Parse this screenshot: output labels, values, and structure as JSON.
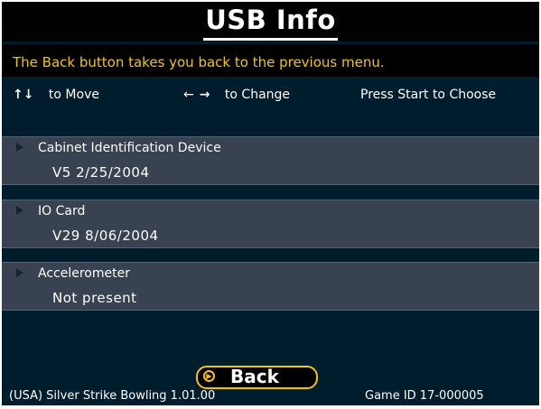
{
  "screen": {
    "title": "USB Info"
  },
  "hint": "The Back button takes you back to the previous menu.",
  "controls": {
    "move": {
      "glyph": "↑↓",
      "label": "to Move"
    },
    "change": {
      "glyph_left": "←",
      "glyph_right": "→",
      "label": "to Change"
    },
    "choose": "Press Start to Choose"
  },
  "items": [
    {
      "label": "Cabinet Identification Device",
      "value": "V5 2/25/2004"
    },
    {
      "label": "IO Card",
      "value": "V29 8/06/2004"
    },
    {
      "label": "Accelerometer",
      "value": "Not present"
    }
  ],
  "back_button": {
    "label": "Back"
  },
  "footer": {
    "game": "(USA) Silver Strike Bowling 1.01.00",
    "game_id": "Game ID 17-000005"
  },
  "colors": {
    "accent": "#f2c40c",
    "background": "#001d2e",
    "panel": "#394250"
  }
}
